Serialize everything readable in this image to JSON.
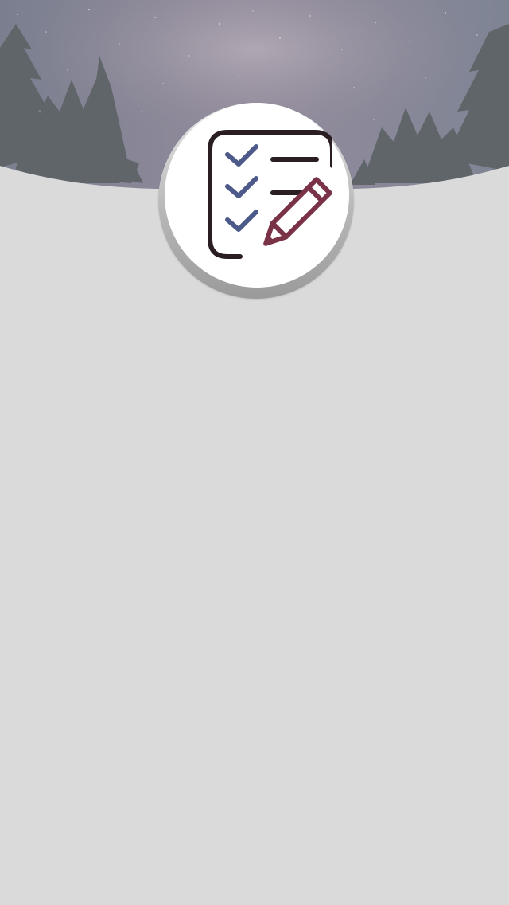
{
  "screen": {
    "name": "splash-screen"
  },
  "header": {
    "background": "night-sky-forest-image",
    "sky_color": "#7f8595",
    "tree_color": "#5d6468"
  },
  "logo": {
    "icon": "checklist-pencil-icon",
    "check_color": "#4c5a8a",
    "line_color": "#2a1e22",
    "pencil_color": "#7a3246"
  },
  "colors": {
    "background": "#dadada",
    "logo_background": "#ffffff"
  }
}
